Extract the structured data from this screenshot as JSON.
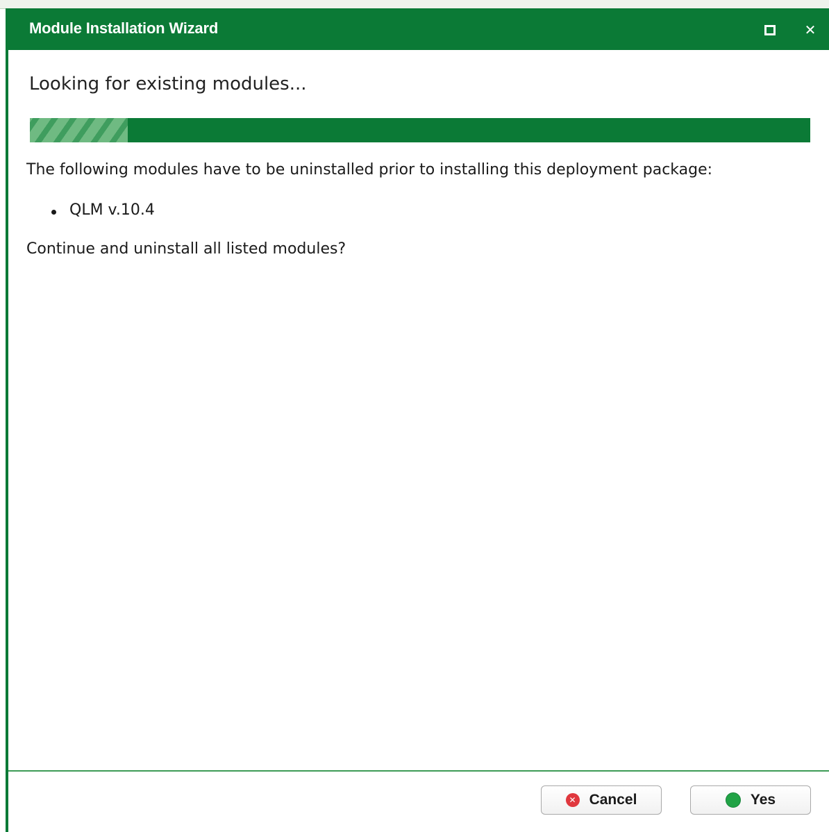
{
  "window": {
    "title": "Module Installation Wizard",
    "maximize_icon": "maximize-icon",
    "close_icon": "close-icon",
    "close_glyph": "✕",
    "accent_color": "#0b7a36"
  },
  "content": {
    "heading": "Looking for existing modules...",
    "progress": {
      "value": 0.125
    },
    "message": "The following modules have to be uninstalled prior to installing this deployment package:",
    "modules": [
      "QLM v.10.4"
    ],
    "question": "Continue and uninstall all listed modules?"
  },
  "footer": {
    "cancel_label": "Cancel",
    "cancel_icon": "cancel-icon",
    "cancel_glyph": "✕",
    "yes_label": "Yes",
    "yes_icon": "green-circle-icon"
  }
}
